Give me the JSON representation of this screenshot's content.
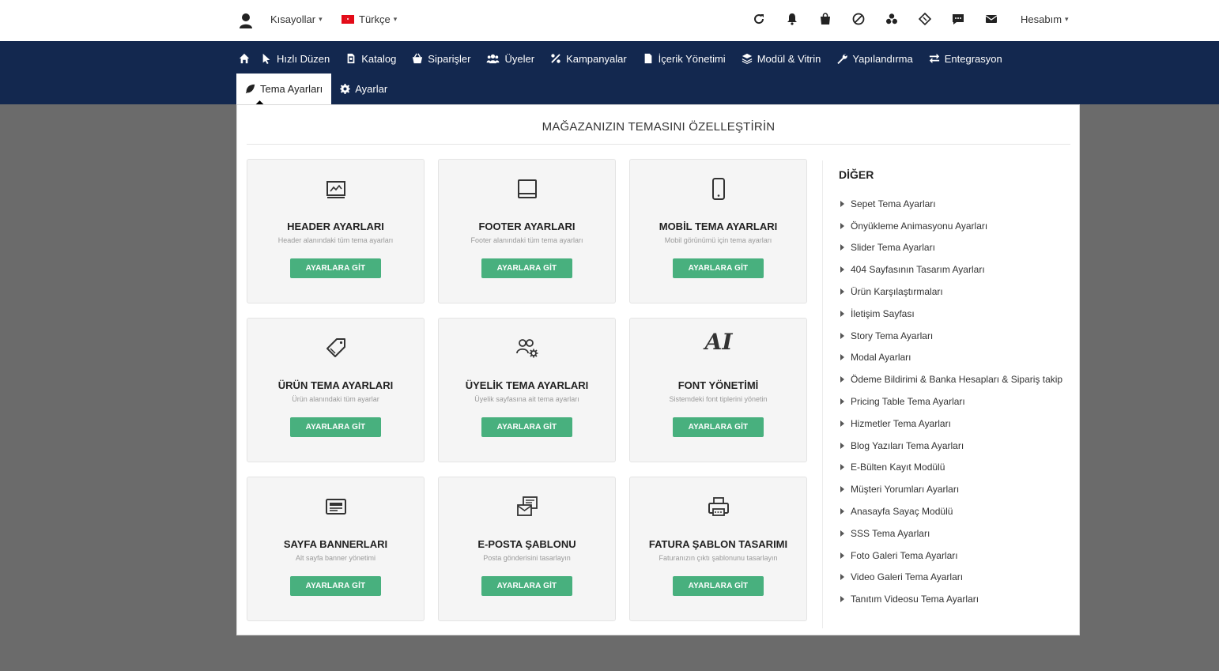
{
  "topbar": {
    "shortcuts_label": "Kısayollar",
    "language_label": "Türkçe",
    "account_label": "Hesabım"
  },
  "nav": {
    "items": [
      {
        "label": "Hızlı Düzen"
      },
      {
        "label": "Katalog"
      },
      {
        "label": "Siparişler"
      },
      {
        "label": "Üyeler"
      },
      {
        "label": "Kampanyalar"
      },
      {
        "label": "İçerik Yönetimi"
      },
      {
        "label": "Modül & Vitrin"
      },
      {
        "label": "Yapılandırma"
      },
      {
        "label": "Entegrasyon"
      }
    ],
    "subtabs": [
      {
        "label": "Tema Ayarları"
      },
      {
        "label": "Ayarlar"
      }
    ]
  },
  "panel": {
    "title": "MAĞAZANIZIN TEMASINI ÖZELLEŞTİRİN",
    "button_label": "AYARLARA GİT",
    "cards": [
      {
        "title": "HEADER AYARLARI",
        "desc": "Header alanındaki tüm tema ayarları",
        "icon": "header-icon"
      },
      {
        "title": "FOOTER AYARLARI",
        "desc": "Footer alanındaki tüm tema ayarları",
        "icon": "footer-icon"
      },
      {
        "title": "MOBİL TEMA AYARLARI",
        "desc": "Mobil görünümü için tema ayarları",
        "icon": "mobile-icon"
      },
      {
        "title": "ÜRÜN TEMA AYARLARI",
        "desc": "Ürün alanındaki tüm ayarlar",
        "icon": "tag-icon"
      },
      {
        "title": "ÜYELİK TEMA AYARLARI",
        "desc": "Üyelik sayfasına ait tema ayarları",
        "icon": "users-gear-icon"
      },
      {
        "title": "FONT YÖNETİMİ",
        "desc": "Sistemdeki font tiplerini yönetin",
        "icon": "ai-font-icon",
        "icon_text": "AI"
      },
      {
        "title": "SAYFA BANNERLARI",
        "desc": "Alt sayfa banner yönetimi",
        "icon": "banner-icon"
      },
      {
        "title": "E-POSTA ŞABLONU",
        "desc": "Posta gönderisini tasarlayın",
        "icon": "email-template-icon"
      },
      {
        "title": "FATURA ŞABLON TASARIMI",
        "desc": "Faturanızın çıktı şablonunu tasarlayın",
        "icon": "printer-icon"
      }
    ]
  },
  "sidebar": {
    "title": "DİĞER",
    "items": [
      "Sepet Tema Ayarları",
      "Önyükleme Animasyonu Ayarları",
      "Slider Tema Ayarları",
      "404 Sayfasının Tasarım Ayarları",
      "Ürün Karşılaştırmaları",
      "İletişim Sayfası",
      "Story Tema Ayarları",
      "Modal Ayarları",
      "Ödeme Bildirimi & Banka Hesapları & Sipariş takip",
      "Pricing Table Tema Ayarları",
      "Hizmetler Tema Ayarları",
      "Blog Yazıları Tema Ayarları",
      "E-Bülten Kayıt Modülü",
      "Müşteri Yorumları Ayarları",
      "Anasayfa Sayaç Modülü",
      "SSS Tema Ayarları",
      "Foto Galeri Tema Ayarları",
      "Video Galeri Tema Ayarları",
      "Tanıtım Videosu Tema Ayarları"
    ]
  }
}
